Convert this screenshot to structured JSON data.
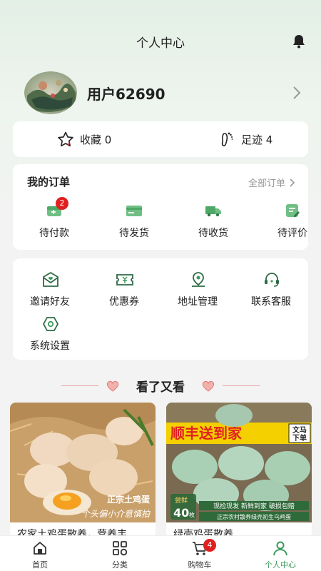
{
  "header": {
    "title": "个人中心",
    "bell_icon": "bell-icon"
  },
  "profile": {
    "username": "用户62690",
    "avatar_icon": "avatar"
  },
  "favorites": {
    "collect_label": "收藏 0",
    "footprint_label": "足迹 4"
  },
  "orders": {
    "title": "我的订单",
    "all_label": "全部订单",
    "items": [
      {
        "label": "待付款",
        "icon": "wallet-icon",
        "badge": "2"
      },
      {
        "label": "待发货",
        "icon": "card-icon"
      },
      {
        "label": "待收货",
        "icon": "truck-icon"
      },
      {
        "label": "待评价",
        "icon": "edit-icon"
      }
    ]
  },
  "tools": [
    {
      "label": "邀请好友",
      "icon": "mail-icon"
    },
    {
      "label": "优惠券",
      "icon": "coupon-icon"
    },
    {
      "label": "地址管理",
      "icon": "location-icon"
    },
    {
      "label": "联系客服",
      "icon": "headset-icon"
    },
    {
      "label": "系统设置",
      "icon": "settings-icon"
    }
  ],
  "recommend": {
    "title": "看了又看",
    "products": [
      {
        "title": "农家土鸡蛋散养，营养丰",
        "overlay_line1": "正宗土鸡蛋",
        "overlay_line2": "个头偏小介意慎拍"
      },
      {
        "title": "绿壳鸡蛋散养",
        "banner": "顺丰送到家",
        "side_tag_line1": "文马",
        "side_tag_line2": "下单",
        "count_label": "尝鲜",
        "count_value": "40",
        "count_unit": "枚",
        "promo_line": "现捡现发 新鲜到家 破损包赔",
        "promo_line2": "正宗农村散养绿壳初生乌鸡蛋"
      }
    ]
  },
  "tabbar": {
    "items": [
      {
        "label": "首页",
        "icon": "home-icon"
      },
      {
        "label": "分类",
        "icon": "grid-icon"
      },
      {
        "label": "购物车",
        "icon": "cart-icon",
        "badge": "4"
      },
      {
        "label": "个人中心",
        "icon": "user-icon",
        "active": true
      }
    ]
  },
  "colors": {
    "accent": "#3b9a5b",
    "badge": "#e02020",
    "heart": "#e57a7a"
  }
}
